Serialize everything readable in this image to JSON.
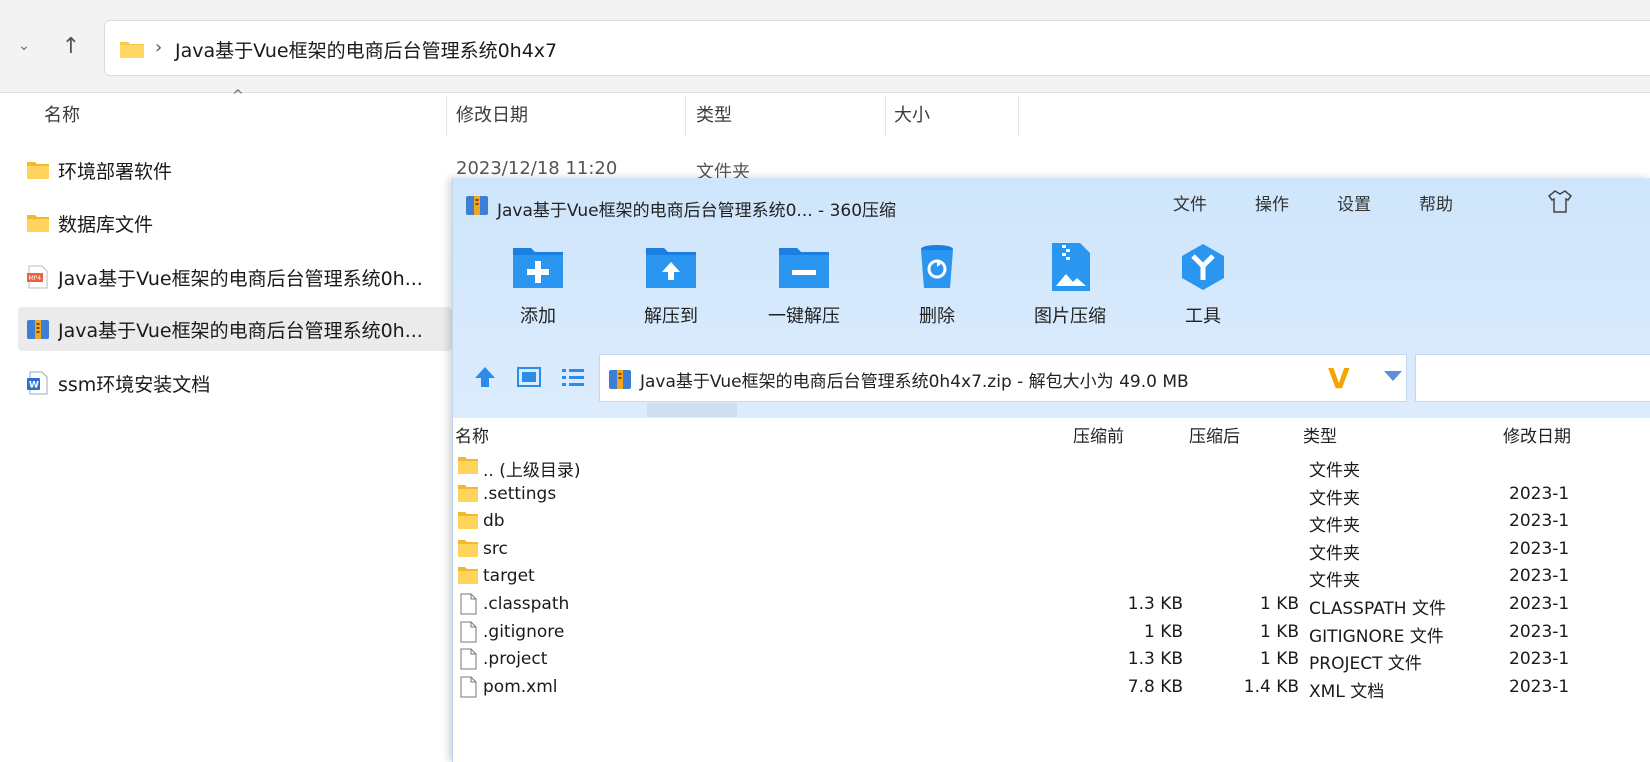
{
  "explorer": {
    "address_path": "Java基于Vue框架的电商后台管理系统0h4x7",
    "columns": {
      "name": "名称",
      "modified": "修改日期",
      "type": "类型",
      "size": "大小"
    },
    "items": [
      {
        "name": "环境部署软件",
        "icon": "folder-icon"
      },
      {
        "name": "数据库文件",
        "icon": "folder-icon"
      },
      {
        "name": "Java基于Vue框架的电商后台管理系统0h...",
        "icon": "mp4-file-icon"
      },
      {
        "name": "Java基于Vue框架的电商后台管理系统0h...",
        "icon": "zip-archive-icon"
      },
      {
        "name": "ssm环境安装文档",
        "icon": "word-document-icon"
      }
    ],
    "first_row_modified": "2023/12/18 11:20",
    "first_row_type": "文件夹"
  },
  "zip_window": {
    "title": "Java基于Vue框架的电商后台管理系统0... - 360压缩",
    "menu": [
      "文件",
      "操作",
      "设置",
      "帮助"
    ],
    "toolbar": [
      {
        "label": "添加",
        "icon": "add-folder-icon"
      },
      {
        "label": "解压到",
        "icon": "extract-to-icon"
      },
      {
        "label": "一键解压",
        "icon": "one-click-extract-icon"
      },
      {
        "label": "删除",
        "icon": "recycle-bin-icon"
      },
      {
        "label": "图片压缩",
        "icon": "image-compress-icon"
      },
      {
        "label": "工具",
        "icon": "tools-icon"
      }
    ],
    "address": "Java基于Vue框架的电商后台管理系统0h4x7.zip - 解包大小为 49.0 MB",
    "columns": {
      "name": "名称",
      "before": "压缩前",
      "after": "压缩后",
      "type": "类型",
      "modified": "修改日期"
    },
    "rows": [
      {
        "name": ".. (上级目录)",
        "before": "",
        "after": "",
        "type": "文件夹",
        "modified": "",
        "kind": "folder"
      },
      {
        "name": ".settings",
        "before": "",
        "after": "",
        "type": "文件夹",
        "modified": "2023-1",
        "kind": "folder"
      },
      {
        "name": "db",
        "before": "",
        "after": "",
        "type": "文件夹",
        "modified": "2023-1",
        "kind": "folder"
      },
      {
        "name": "src",
        "before": "",
        "after": "",
        "type": "文件夹",
        "modified": "2023-1",
        "kind": "folder"
      },
      {
        "name": "target",
        "before": "",
        "after": "",
        "type": "文件夹",
        "modified": "2023-1",
        "kind": "folder"
      },
      {
        "name": ".classpath",
        "before": "1.3 KB",
        "after": "1 KB",
        "type": "CLASSPATH 文件",
        "modified": "2023-1",
        "kind": "file"
      },
      {
        "name": ".gitignore",
        "before": "1 KB",
        "after": "1 KB",
        "type": "GITIGNORE 文件",
        "modified": "2023-1",
        "kind": "file"
      },
      {
        "name": ".project",
        "before": "1.3 KB",
        "after": "1 KB",
        "type": "PROJECT 文件",
        "modified": "2023-1",
        "kind": "file"
      },
      {
        "name": "pom.xml",
        "before": "7.8 KB",
        "after": "1.4 KB",
        "type": "XML 文档",
        "modified": "2023-1",
        "kind": "file"
      }
    ]
  },
  "colors": {
    "accent_blue": "#2b8de8",
    "folder_yellow": "#f7c948",
    "header_bg": "#cfe5fb"
  }
}
